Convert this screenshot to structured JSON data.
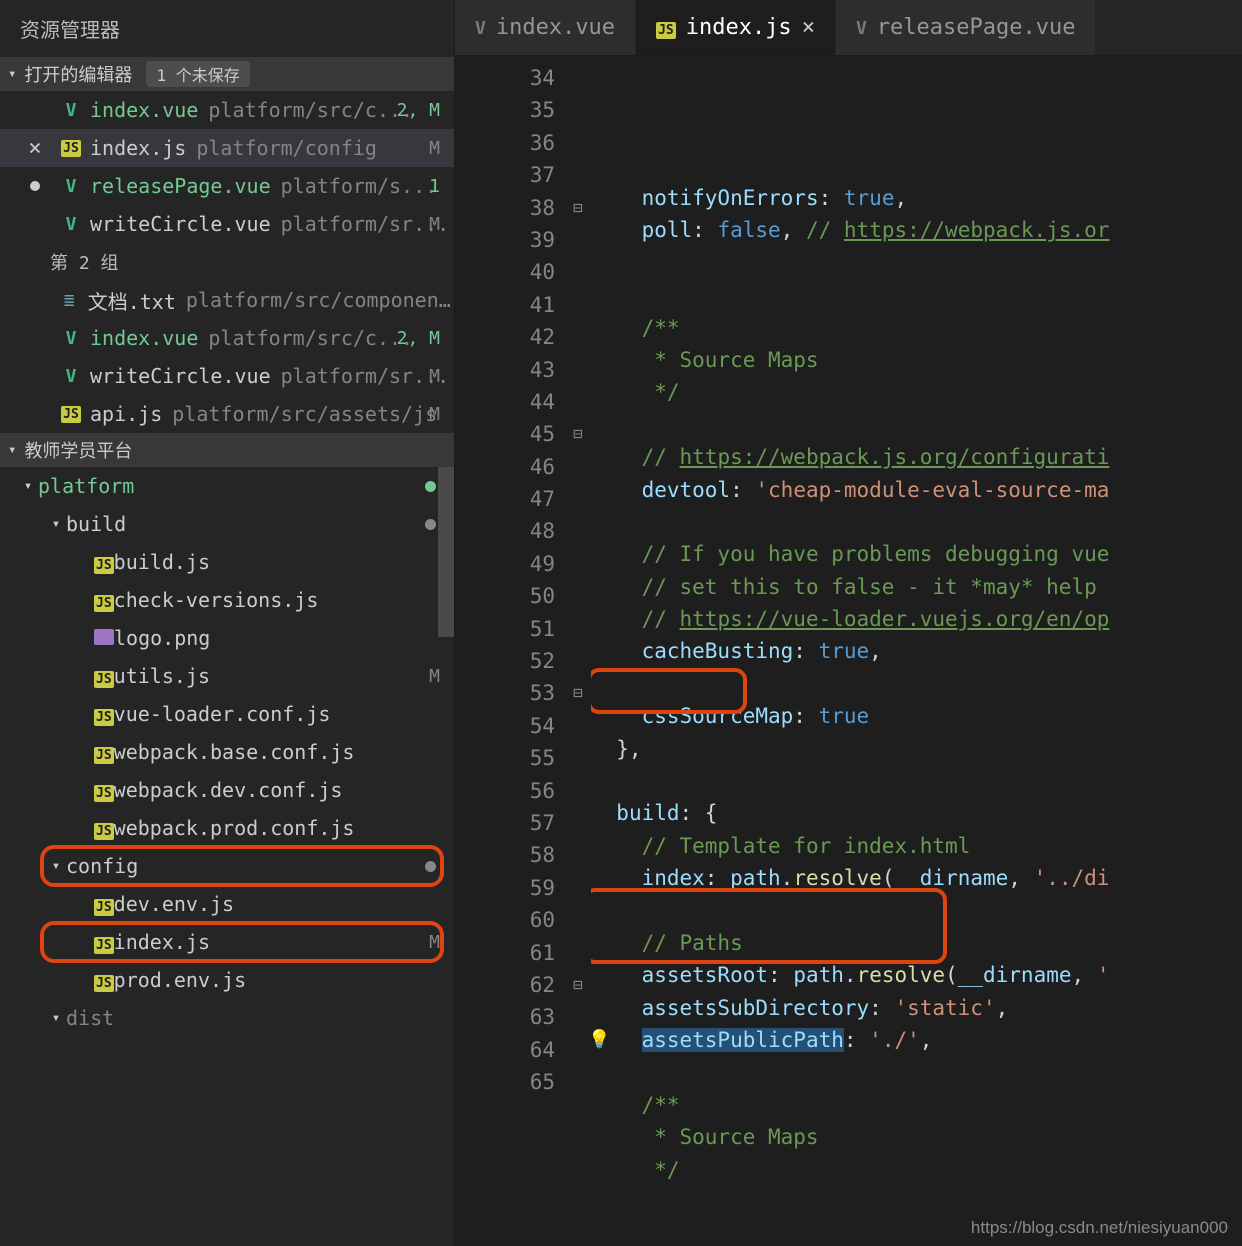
{
  "sidebar": {
    "title": "资源管理器",
    "openEditors": {
      "header": "打开的编辑器",
      "badge": "1 个未保存",
      "group2_label": "第 2 组",
      "group1": [
        {
          "icon": "vue",
          "name": "index.vue",
          "path": "platform/src/c...",
          "status": "2, M",
          "green": true
        },
        {
          "icon": "js",
          "name": "index.js",
          "path": "platform/config",
          "status": "M",
          "active": true,
          "close": true
        },
        {
          "icon": "vue",
          "name": "releasePage.vue",
          "path": "platform/s...",
          "status": "1",
          "green": true,
          "dirty": true
        },
        {
          "icon": "vue",
          "name": "writeCircle.vue",
          "path": "platform/sr...",
          "status": "M"
        }
      ],
      "group2": [
        {
          "icon": "txt",
          "name": "文档.txt",
          "path": "platform/src/components"
        },
        {
          "icon": "vue",
          "name": "index.vue",
          "path": "platform/src/c...",
          "status": "2, M",
          "green": true
        },
        {
          "icon": "vue",
          "name": "writeCircle.vue",
          "path": "platform/sr...",
          "status": "M"
        },
        {
          "icon": "js",
          "name": "api.js",
          "path": "platform/src/assets/js",
          "status": "M"
        }
      ]
    },
    "folder": {
      "header": "教师学员平台",
      "tree": [
        {
          "level": 0,
          "arrow": true,
          "name": "platform",
          "green": true,
          "dotGreen": true
        },
        {
          "level": 1,
          "arrow": true,
          "name": "build",
          "dotGray": true
        },
        {
          "level": 2,
          "icon": "js",
          "name": "build.js"
        },
        {
          "level": 2,
          "icon": "js",
          "name": "check-versions.js"
        },
        {
          "level": 2,
          "icon": "img",
          "name": "logo.png"
        },
        {
          "level": 2,
          "icon": "js",
          "name": "utils.js",
          "status": "M"
        },
        {
          "level": 2,
          "icon": "js",
          "name": "vue-loader.conf.js"
        },
        {
          "level": 2,
          "icon": "js",
          "name": "webpack.base.conf.js"
        },
        {
          "level": 2,
          "icon": "js",
          "name": "webpack.dev.conf.js"
        },
        {
          "level": 2,
          "icon": "js",
          "name": "webpack.prod.conf.js"
        },
        {
          "level": 1,
          "arrow": true,
          "name": "config",
          "dotGray": true,
          "hlBox": true
        },
        {
          "level": 2,
          "icon": "js",
          "name": "dev.env.js"
        },
        {
          "level": 2,
          "icon": "js",
          "name": "index.js",
          "status": "M",
          "hlBox": true
        },
        {
          "level": 2,
          "icon": "js",
          "name": "prod.env.js"
        },
        {
          "level": 1,
          "arrow": true,
          "name": "dist",
          "dim": true
        }
      ]
    }
  },
  "tabs": [
    {
      "icon": "vue-gray",
      "label": "index.vue"
    },
    {
      "icon": "js",
      "label": "index.js",
      "active": true,
      "close": true
    },
    {
      "icon": "vue-gray",
      "label": "releasePage.vue"
    }
  ],
  "editor": {
    "startLine": 34,
    "folds": {
      "38": "⊟",
      "45": "⊟",
      "53": "⊟",
      "62": "⊟"
    },
    "bulbLine": 60,
    "lines": [
      [
        {
          "t": "    ",
          "c": ""
        },
        {
          "t": "notifyOnErrors",
          "c": "prop"
        },
        {
          "t": ": ",
          "c": "punc"
        },
        {
          "t": "true",
          "c": "key"
        },
        {
          "t": ",",
          "c": "punc"
        }
      ],
      [
        {
          "t": "    ",
          "c": ""
        },
        {
          "t": "poll",
          "c": "prop"
        },
        {
          "t": ": ",
          "c": "punc"
        },
        {
          "t": "false",
          "c": "key"
        },
        {
          "t": ", ",
          "c": "punc"
        },
        {
          "t": "// ",
          "c": "comm"
        },
        {
          "t": "https://webpack.js.or",
          "c": "link"
        }
      ],
      [],
      [],
      [
        {
          "t": "    ",
          "c": ""
        },
        {
          "t": "/**",
          "c": "comm"
        }
      ],
      [
        {
          "t": "     * Source Maps",
          "c": "comm"
        }
      ],
      [
        {
          "t": "     */",
          "c": "comm"
        }
      ],
      [],
      [
        {
          "t": "    ",
          "c": ""
        },
        {
          "t": "// ",
          "c": "comm"
        },
        {
          "t": "https://webpack.js.org/configurati",
          "c": "link"
        }
      ],
      [
        {
          "t": "    ",
          "c": ""
        },
        {
          "t": "devtool",
          "c": "prop"
        },
        {
          "t": ": ",
          "c": "punc"
        },
        {
          "t": "'cheap-module-eval-source-ma",
          "c": "str"
        }
      ],
      [],
      [
        {
          "t": "    ",
          "c": ""
        },
        {
          "t": "// If you have problems debugging vue",
          "c": "comm"
        }
      ],
      [
        {
          "t": "    ",
          "c": ""
        },
        {
          "t": "// set this to false - it *may* help",
          "c": "comm"
        }
      ],
      [
        {
          "t": "    ",
          "c": ""
        },
        {
          "t": "// ",
          "c": "comm"
        },
        {
          "t": "https://vue-loader.vuejs.org/en/op",
          "c": "link"
        }
      ],
      [
        {
          "t": "    ",
          "c": ""
        },
        {
          "t": "cacheBusting",
          "c": "prop"
        },
        {
          "t": ": ",
          "c": "punc"
        },
        {
          "t": "true",
          "c": "key"
        },
        {
          "t": ",",
          "c": "punc"
        }
      ],
      [],
      [
        {
          "t": "    ",
          "c": ""
        },
        {
          "t": "cssSourceMap",
          "c": "prop"
        },
        {
          "t": ": ",
          "c": "punc"
        },
        {
          "t": "true",
          "c": "key"
        }
      ],
      [
        {
          "t": "  },",
          "c": "punc"
        }
      ],
      [],
      [
        {
          "t": "  ",
          "c": ""
        },
        {
          "t": "build",
          "c": "prop"
        },
        {
          "t": ": {",
          "c": "punc"
        }
      ],
      [
        {
          "t": "    ",
          "c": ""
        },
        {
          "t": "// Template for index.html",
          "c": "comm"
        }
      ],
      [
        {
          "t": "    ",
          "c": ""
        },
        {
          "t": "index",
          "c": "prop"
        },
        {
          "t": ": ",
          "c": "punc"
        },
        {
          "t": "path",
          "c": "var"
        },
        {
          "t": ".",
          "c": "punc"
        },
        {
          "t": "resolve",
          "c": "func"
        },
        {
          "t": "(",
          "c": "punc"
        },
        {
          "t": "__dirname",
          "c": "var"
        },
        {
          "t": ", ",
          "c": "punc"
        },
        {
          "t": "'../di",
          "c": "str"
        }
      ],
      [],
      [
        {
          "t": "    ",
          "c": ""
        },
        {
          "t": "// Paths",
          "c": "comm"
        }
      ],
      [
        {
          "t": "    ",
          "c": ""
        },
        {
          "t": "assetsRoot",
          "c": "prop"
        },
        {
          "t": ": ",
          "c": "punc"
        },
        {
          "t": "path",
          "c": "var"
        },
        {
          "t": ".",
          "c": "punc"
        },
        {
          "t": "resolve",
          "c": "func"
        },
        {
          "t": "(",
          "c": "punc"
        },
        {
          "t": "__dirname",
          "c": "var"
        },
        {
          "t": ", ",
          "c": "punc"
        },
        {
          "t": "'",
          "c": "str"
        }
      ],
      [
        {
          "t": "    ",
          "c": ""
        },
        {
          "t": "assetsSubDirectory",
          "c": "prop"
        },
        {
          "t": ": ",
          "c": "punc"
        },
        {
          "t": "'static'",
          "c": "str"
        },
        {
          "t": ",",
          "c": "punc"
        }
      ],
      [
        {
          "t": "    ",
          "c": ""
        },
        {
          "t": "assetsPublicPath",
          "c": "prop",
          "sel": true
        },
        {
          "t": ": ",
          "c": "punc"
        },
        {
          "t": "'./'",
          "c": "str"
        },
        {
          "t": ",",
          "c": "punc"
        }
      ],
      [],
      [
        {
          "t": "    ",
          "c": ""
        },
        {
          "t": "/**",
          "c": "comm"
        }
      ],
      [
        {
          "t": "     * Source Maps",
          "c": "comm"
        }
      ],
      [
        {
          "t": "     */",
          "c": "comm"
        }
      ],
      []
    ]
  },
  "watermark": "https://blog.csdn.net/niesiyuan000"
}
